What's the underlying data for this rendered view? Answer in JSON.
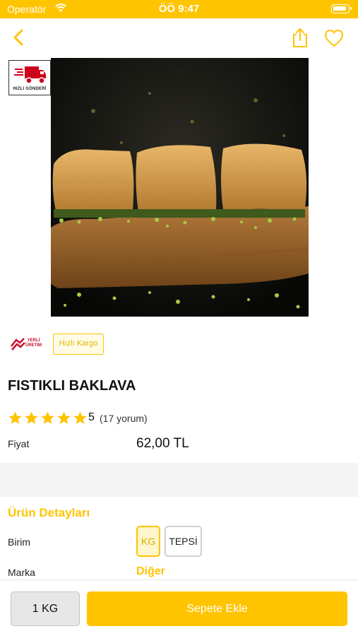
{
  "status_bar": {
    "carrier": "Operatör",
    "time": "ÖÖ 9:47"
  },
  "badges": {
    "fast_shipping": "HIZLI GÖNDERİ",
    "local_line1": "YERLİ",
    "local_line2": "ÜRETİM",
    "fast_cargo": "Hızlı Kargo"
  },
  "product": {
    "name": "FISTIKLI BAKLAVA",
    "rating": {
      "value": "5",
      "count": "(17 yorum)",
      "stars": 5
    },
    "price_label": "Fiyat",
    "price": "62,00 TL"
  },
  "details": {
    "title": "Ürün Detayları",
    "unit_label": "Birim",
    "units": [
      "KG",
      "TEPSİ"
    ],
    "selected_unit": "KG",
    "brand_label": "Marka",
    "brand_value": "Diğer"
  },
  "bottom": {
    "quantity": "1 KG",
    "add_to_cart": "Sepete Ekle"
  },
  "colors": {
    "accent": "#FFC400",
    "danger": "#C8102E"
  },
  "icons": {
    "back": "chevron-left-icon",
    "share": "share-icon",
    "favorite": "heart-icon",
    "truck": "truck-icon",
    "star": "star-icon"
  }
}
